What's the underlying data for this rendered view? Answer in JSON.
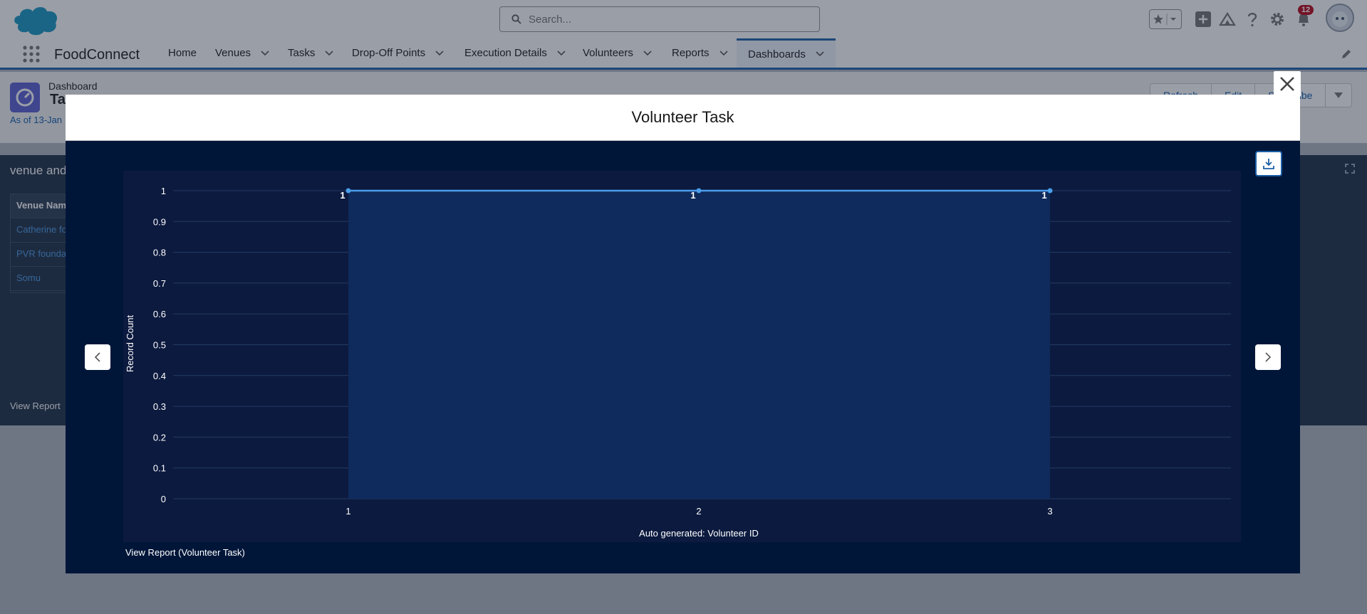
{
  "header": {
    "search_placeholder": "Search...",
    "notification_count": "12"
  },
  "nav": {
    "app_name": "FoodConnect",
    "tabs": [
      {
        "label": "Home",
        "has_menu": false
      },
      {
        "label": "Venues",
        "has_menu": true
      },
      {
        "label": "Tasks",
        "has_menu": true
      },
      {
        "label": "Drop-Off Points",
        "has_menu": true
      },
      {
        "label": "Execution Details",
        "has_menu": true
      },
      {
        "label": "Volunteers",
        "has_menu": true
      },
      {
        "label": "Reports",
        "has_menu": true
      },
      {
        "label": "Dashboards",
        "has_menu": true,
        "active": true
      }
    ]
  },
  "page": {
    "label": "Dashboard",
    "title": "Ta",
    "as_of": "As of 13-Jan",
    "buttons": [
      "Refresh",
      "Edit",
      "Subscribe"
    ]
  },
  "background_card": {
    "title": "venue and",
    "table_header": "Venue Nam",
    "rows": [
      "Catherine fo",
      "PVR founda",
      "Somu"
    ],
    "view_report": "View Report"
  },
  "modal": {
    "title": "Volunteer Task",
    "view_report": "View Report (Volunteer Task)"
  },
  "colors": {
    "brand": "#1b5fa8",
    "modal_bg": "#001639",
    "plot_bg": "#0c1a3f",
    "area_fill": "#0f2a5c",
    "line": "#4a9eea"
  },
  "chart_data": {
    "type": "area",
    "title": "",
    "xlabel": "Auto generated: Volunteer ID",
    "ylabel": "Record Count",
    "categories": [
      "1",
      "2",
      "3"
    ],
    "values": [
      1,
      1,
      1
    ],
    "data_labels": [
      "1",
      "1",
      "1"
    ],
    "ylim": [
      0,
      1
    ],
    "yticks": [
      "0",
      "0.1",
      "0.2",
      "0.3",
      "0.4",
      "0.5",
      "0.6",
      "0.7",
      "0.8",
      "0.9",
      "1"
    ],
    "grid": true,
    "legend": "none"
  }
}
